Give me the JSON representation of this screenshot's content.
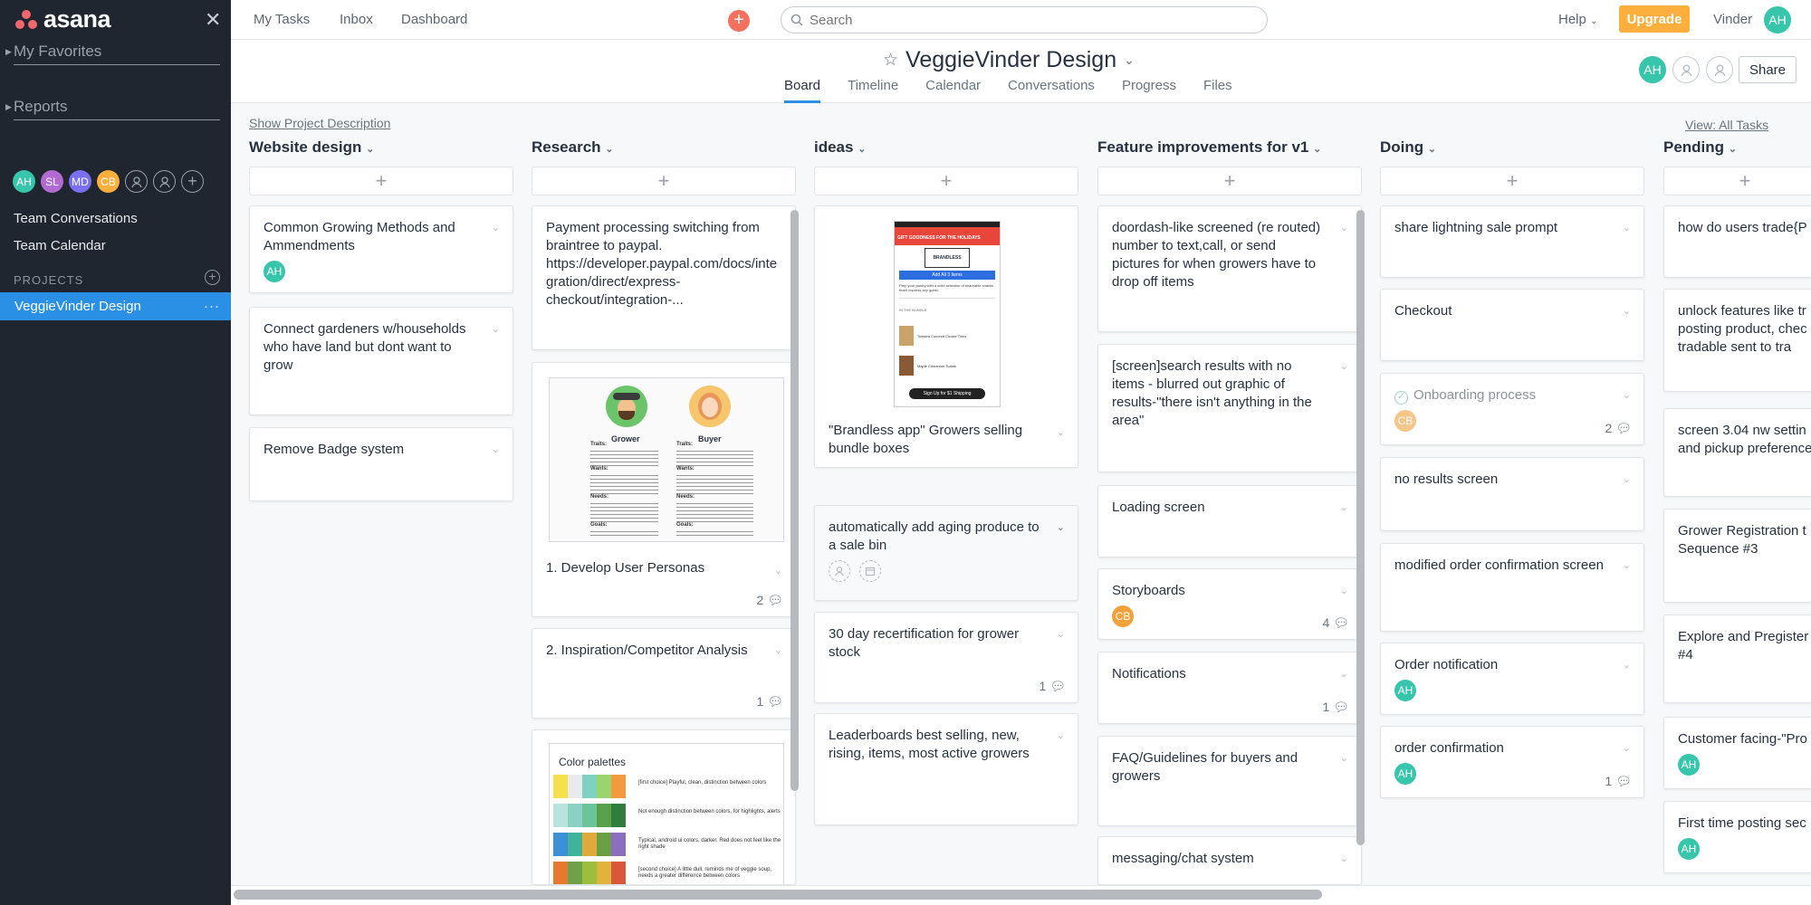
{
  "sidebar": {
    "brand": "asana",
    "favorites": "My Favorites",
    "reports": "Reports",
    "team_avatars": [
      {
        "initials": "AH",
        "color": "#37c5ab"
      },
      {
        "initials": "SL",
        "color": "#b36bd4"
      },
      {
        "initials": "MD",
        "color": "#7a6ff0"
      },
      {
        "initials": "CB",
        "color": "#fcaf3c"
      }
    ],
    "team_conversations": "Team Conversations",
    "team_calendar": "Team Calendar",
    "projects_label": "PROJECTS",
    "active_project": "VeggieVinder Design"
  },
  "topbar": {
    "nav": [
      "My Tasks",
      "Inbox",
      "Dashboard"
    ],
    "search_placeholder": "Search",
    "help": "Help",
    "upgrade": "Upgrade",
    "user_name": "Vinder",
    "user_initials": "AH",
    "colors": {
      "accent": "#2a90e6",
      "upgrade": "#fcaf3c",
      "quick_add": "#f4715f"
    }
  },
  "project": {
    "title": "VeggieVinder Design",
    "tabs": [
      "Board",
      "Timeline",
      "Calendar",
      "Conversations",
      "Progress",
      "Files"
    ],
    "active_tab": "Board",
    "member_initials": "AH",
    "share": "Share",
    "show_description": "Show Project Description",
    "view_all": "View: All Tasks"
  },
  "columns": [
    {
      "name": "Website design",
      "cards": [
        {
          "text": "Common Growing Methods and Ammendments",
          "assignee": "AH"
        },
        {
          "text": "Connect gardeners w/households who have land but dont want to grow"
        },
        {
          "text": "Remove Badge system"
        }
      ]
    },
    {
      "name": "Research",
      "cards": [
        {
          "text": "Payment processing switching from braintree to paypal. https://developer.paypal.com/docs/integration/direct/express-checkout/integration-..."
        },
        {
          "text": "1. Develop User Personas",
          "comments": "2",
          "persona": {
            "left": "Grower",
            "right": "Buyer",
            "heads": [
              "Traits:",
              "Wants:",
              "Needs:",
              "Goals:"
            ]
          }
        },
        {
          "text": "2. Inspiration/Competitor Analysis",
          "comments": "1"
        },
        {
          "text": "Color palettes",
          "palette_notes": [
            "[first choice] Playful, clean, distinction between colors",
            "Not enough distinction between colors, for highlights, alerts",
            "Typical, android ui colors, darker. Red does not feel like the right shade",
            "[second choice] A little dull, reminds me of veggie soup, needs a greater difference between colors"
          ]
        }
      ]
    },
    {
      "name": "ideas",
      "cards": [
        {
          "text": "\"Brandless app\" Growers selling bundle boxes",
          "phone": {
            "banner": "GIFT GOODNESS FOR THE HOLIDAYS",
            "brand": "BRANDLESS",
            "button": "Add All 3 Items",
            "copy": "Prep your pantry with a solid selection of shareable snacks that'll impress any guest.",
            "section": "IN THE BUNDLE",
            "item1": "Toasted Coconut Cookie Thins",
            "item2": "Maple Cinnamon Toasts",
            "cta": "Sign Up for $1 Shipping"
          }
        },
        {
          "text": "automatically add aging produce to a sale bin"
        },
        {
          "text": "30 day recertification for grower stock",
          "comments": "1"
        },
        {
          "text": "Leaderboards best selling, new, rising, items, most active growers"
        }
      ]
    },
    {
      "name": "Feature improvements for v1",
      "cards": [
        {
          "text": "doordash-like screened (re routed) number to text,call, or send pictures for when growers have to drop off items"
        },
        {
          "text": "[screen]search results with no items - blurred out graphic of results-\"there isn't anything in the area\""
        },
        {
          "text": "Loading screen"
        },
        {
          "text": "Storyboards",
          "assignee": "CB",
          "comments": "4"
        },
        {
          "text": "Notifications",
          "comments": "1"
        },
        {
          "text": "FAQ/Guidelines for buyers and growers"
        },
        {
          "text": "messaging/chat system"
        }
      ]
    },
    {
      "name": "Doing",
      "cards": [
        {
          "text": "share lightning sale prompt"
        },
        {
          "text": "Checkout"
        },
        {
          "text": "Onboarding process",
          "assignee": "CB",
          "comments": "2",
          "completed": true
        },
        {
          "text": "no results screen"
        },
        {
          "text": "modified order confirmation screen"
        },
        {
          "text": "Order notification",
          "assignee": "AH"
        },
        {
          "text": "order confirmation",
          "assignee": "AH",
          "comments": "1"
        }
      ]
    },
    {
      "name": "Pending",
      "cards": [
        {
          "text": "how do users trade{P"
        },
        {
          "text": "unlock features like tr posting product, chec is tradable sent to tra"
        },
        {
          "text": "screen 3.04 nw settin and pickup preference"
        },
        {
          "text": "Grower Registration t Sequence #3"
        },
        {
          "text": "Explore and Pregister #4"
        },
        {
          "text": "Customer facing-\"Pro",
          "assignee": "AH"
        },
        {
          "text": "First time posting sec",
          "assignee": "AH"
        }
      ]
    }
  ]
}
